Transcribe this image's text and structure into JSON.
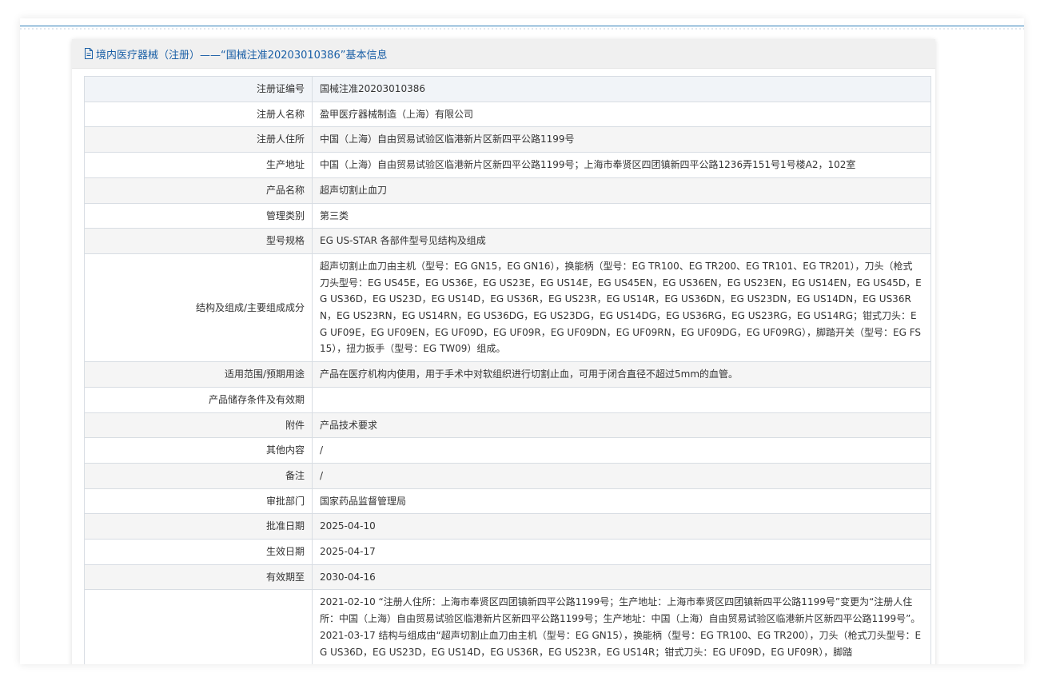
{
  "header": {
    "title": "境内医疗器械（注册）——“国械注准20203010386”基本信息"
  },
  "rows": [
    {
      "label": "注册证编号",
      "value": "国械注准20203010386"
    },
    {
      "label": "注册人名称",
      "value": "盈甲医疗器械制造（上海）有限公司"
    },
    {
      "label": "注册人住所",
      "value": "中国（上海）自由贸易试验区临港新片区新四平公路1199号"
    },
    {
      "label": "生产地址",
      "value": "中国（上海）自由贸易试验区临港新片区新四平公路1199号；上海市奉贤区四团镇新四平公路1236弄151号1号楼A2，102室"
    },
    {
      "label": "产品名称",
      "value": "超声切割止血刀"
    },
    {
      "label": "管理类别",
      "value": "第三类"
    },
    {
      "label": "型号规格",
      "value": "EG US-STAR 各部件型号见结构及组成"
    },
    {
      "label": "结构及组成/主要组成成分",
      "value": "超声切割止血刀由主机（型号：EG GN15，EG GN16），换能柄（型号：EG TR100、EG TR200、EG TR101、EG TR201），刀头（枪式刀头型号：EG US45E，EG US36E，EG US23E，EG US14E，EG US45EN，EG US36EN，EG US23EN，EG US14EN，EG US45D，EG US36D，EG US23D，EG US14D，EG US36R，EG US23R，EG US14R，EG US36DN，EG US23DN，EG US14DN，EG US36RN，EG US23RN，EG US14RN，EG US36DG，EG US23DG，EG US14DG，EG US36RG，EG US23RG，EG US14RG；钳式刀头：EG UF09E，EG UF09EN，EG UF09D，EG UF09R，EG UF09DN，EG UF09RN，EG UF09DG，EG UF09RG），脚踏开关（型号：EG FS15），扭力扳手（型号：EG TW09）组成。"
    },
    {
      "label": "适用范围/预期用途",
      "value": "产品在医疗机构内使用，用于手术中对软组织进行切割止血，可用于闭合直径不超过5mm的血管。"
    },
    {
      "label": "产品储存条件及有效期",
      "value": ""
    },
    {
      "label": "附件",
      "value": "产品技术要求"
    },
    {
      "label": "其他内容",
      "value": "/"
    },
    {
      "label": "备注",
      "value": "/"
    },
    {
      "label": "审批部门",
      "value": "国家药品监督管理局"
    },
    {
      "label": "批准日期",
      "value": "2025-04-10"
    },
    {
      "label": "生效日期",
      "value": "2025-04-17"
    },
    {
      "label": "有效期至",
      "value": "2030-04-16"
    },
    {
      "label": "",
      "value": "2021-02-10 “注册人住所：上海市奉贤区四团镇新四平公路1199号；生产地址：上海市奉贤区四团镇新四平公路1199号”变更为“注册人住所：中国（上海）自由贸易试验区临港新片区新四平公路1199号；生产地址：中国（上海）自由贸易试验区临港新片区新四平公路1199号”。\n2021-03-17 结构与组成由“超声切割止血刀由主机（型号：EG GN15），换能柄（型号：EG TR100、EG TR200），刀头（枪式刀头型号：EG US36D，EG US23D，EG US14D，EG US36R，EG US23R，EG US14R；钳式刀头：EG UF09D，EG UF09R），脚踏"
    }
  ],
  "colors": {
    "header_text": "#1a5fa6",
    "top_line": "#2e7fb8",
    "border": "#d8dde3",
    "row_alt": "#f5f5f5",
    "header_bg": "#f0f0f0"
  }
}
